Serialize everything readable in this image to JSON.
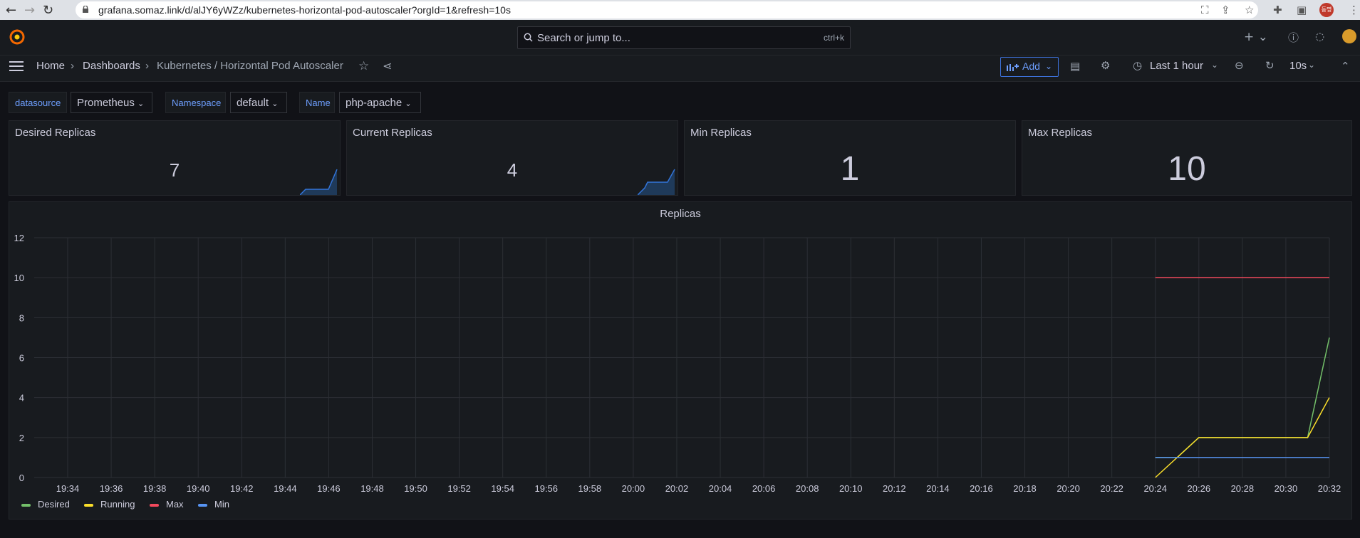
{
  "browser": {
    "url": "grafana.somaz.link/d/alJY6yWZz/kubernetes-horizontal-pod-autoscaler?orgId=1&refresh=10s",
    "profile_label": "동명"
  },
  "topbar": {
    "search_placeholder": "Search or jump to...",
    "search_shortcut": "ctrl+k"
  },
  "breadcrumb": {
    "home": "Home",
    "dashboards": "Dashboards",
    "current": "Kubernetes / Horizontal Pod Autoscaler"
  },
  "toolbar": {
    "add_label": "Add",
    "time_range": "Last 1 hour",
    "refresh_interval": "10s"
  },
  "variables": [
    {
      "label": "datasource",
      "value": "Prometheus"
    },
    {
      "label": "Namespace",
      "value": "default"
    },
    {
      "label": "Name",
      "value": "php-apache"
    }
  ],
  "stats": {
    "desired": {
      "title": "Desired Replicas",
      "value": "7"
    },
    "current": {
      "title": "Current Replicas",
      "value": "4"
    },
    "min": {
      "title": "Min Replicas",
      "value": "1"
    },
    "max": {
      "title": "Max Replicas",
      "value": "10"
    }
  },
  "colors": {
    "desired": "#73bf69",
    "running": "#fade2a",
    "max": "#f2495c",
    "min": "#5794f2",
    "accent": "#6e9fff"
  },
  "chart_data": {
    "type": "line",
    "title": "Replicas",
    "ylim": [
      0,
      12
    ],
    "yticks": [
      0,
      2,
      4,
      6,
      8,
      10,
      12
    ],
    "xticks": [
      "19:34",
      "19:36",
      "19:38",
      "19:40",
      "19:42",
      "19:44",
      "19:46",
      "19:48",
      "19:50",
      "19:52",
      "19:54",
      "19:56",
      "19:58",
      "20:00",
      "20:02",
      "20:04",
      "20:06",
      "20:08",
      "20:10",
      "20:12",
      "20:14",
      "20:16",
      "20:18",
      "20:20",
      "20:22",
      "20:24",
      "20:26",
      "20:28",
      "20:30",
      "20:32"
    ],
    "grid": true,
    "legend_position": "bottom-left",
    "series": [
      {
        "name": "Desired",
        "color": "#73bf69",
        "x": [
          "20:24",
          "20:25",
          "20:26",
          "20:31",
          "20:32"
        ],
        "values": [
          1,
          1,
          2,
          2,
          7
        ]
      },
      {
        "name": "Running",
        "color": "#fade2a",
        "x": [
          "20:24",
          "20:25",
          "20:26",
          "20:31",
          "20:32"
        ],
        "values": [
          0,
          1,
          2,
          2,
          4
        ]
      },
      {
        "name": "Max",
        "color": "#f2495c",
        "x": [
          "20:24",
          "20:32"
        ],
        "values": [
          10,
          10
        ]
      },
      {
        "name": "Min",
        "color": "#5794f2",
        "x": [
          "20:24",
          "20:32"
        ],
        "values": [
          1,
          1
        ]
      }
    ]
  }
}
